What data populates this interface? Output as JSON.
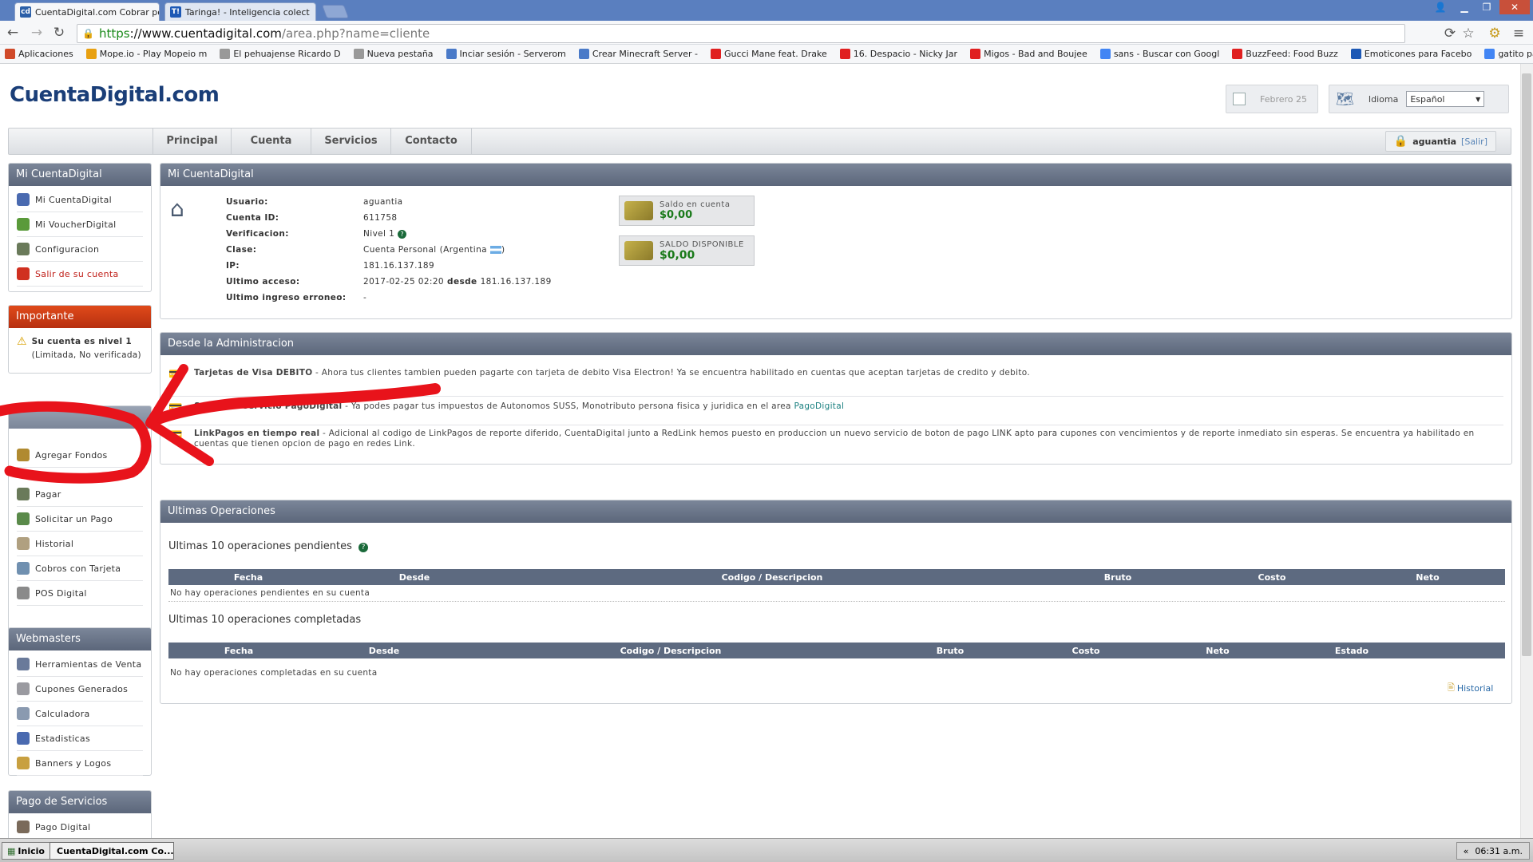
{
  "browser": {
    "tabs": [
      {
        "title": "CuentaDigital.com Cobrar po",
        "active": true,
        "icon": "cd-icon"
      },
      {
        "title": "Taringa! - Inteligencia colect",
        "active": false,
        "icon": "taringa-icon"
      }
    ],
    "url_https": "https",
    "url_host": "://www.cuentadigital.com",
    "url_path": "/area.php?name=cliente",
    "bookmarks": [
      {
        "label": "Aplicaciones",
        "icon": "apps-icon",
        "color": "#d04a2a"
      },
      {
        "label": "Mope.io - Play Mopeio m",
        "icon": "mope-icon",
        "color": "#e8a010"
      },
      {
        "label": "El pehuajense Ricardo D",
        "icon": "page-icon",
        "color": "#999999"
      },
      {
        "label": "Nueva pestaña",
        "icon": "page-icon",
        "color": "#999999"
      },
      {
        "label": "Inciar sesión - Serverom",
        "icon": "server-icon",
        "color": "#4a7ac8"
      },
      {
        "label": "Crear Minecraft Server -",
        "icon": "server-icon",
        "color": "#4a7ac8"
      },
      {
        "label": "Gucci Mane feat. Drake",
        "icon": "youtube-icon",
        "color": "#e02020"
      },
      {
        "label": "16. Despacio - Nicky Jar",
        "icon": "youtube-icon",
        "color": "#e02020"
      },
      {
        "label": "Migos - Bad and Boujee",
        "icon": "youtube-icon",
        "color": "#e02020"
      },
      {
        "label": "sans - Buscar con Googl",
        "icon": "google-icon",
        "color": "#4285f4"
      },
      {
        "label": "BuzzFeed: Food Buzz",
        "icon": "buzzfeed-icon",
        "color": "#e02020"
      },
      {
        "label": "Emoticones para Facebo",
        "icon": "taringa-icon",
        "color": "#1c58b5"
      },
      {
        "label": "gatito para hacer pixel a",
        "icon": "google-icon",
        "color": "#4285f4"
      }
    ]
  },
  "header": {
    "logo_text": "CuentaDigital.com",
    "date": "Febrero 25",
    "idioma_label": "Idioma",
    "idioma_value": "Español"
  },
  "nav": {
    "items": [
      "Principal",
      "Cuenta",
      "Servicios",
      "Contacto"
    ],
    "username": "aguantia",
    "salir": "[Salir]"
  },
  "sidebar": {
    "mi_cuenta": {
      "title": "Mi CuentaDigital",
      "items": [
        {
          "label": "Mi CuentaDigital",
          "icon": "home-icon"
        },
        {
          "label": "Mi VoucherDigital",
          "icon": "voucher-icon"
        },
        {
          "label": "Configuracion",
          "icon": "user-config-icon"
        },
        {
          "label": "Salir de su cuenta",
          "icon": "close-circle-icon"
        }
      ]
    },
    "importante": {
      "title": "Importante",
      "text": "Su cuenta es nivel 1",
      "subtext": "(Limitada, No verificada)"
    },
    "operaciones": {
      "items": [
        {
          "label": "Agregar Fondos",
          "icon": "add-funds-icon"
        },
        {
          "label": "Pagar",
          "icon": "pay-icon"
        },
        {
          "label": "Solicitar un Pago",
          "icon": "request-pay-icon"
        },
        {
          "label": "Historial",
          "icon": "history-icon"
        },
        {
          "label": "Cobros con Tarjeta",
          "icon": "card-icon"
        },
        {
          "label": "POS Digital",
          "icon": "pos-icon"
        }
      ]
    },
    "webmasters": {
      "title": "Webmasters",
      "items": [
        {
          "label": "Herramientas de Venta",
          "icon": "tools-icon"
        },
        {
          "label": "Cupones Generados",
          "icon": "coupons-icon"
        },
        {
          "label": "Calculadora",
          "icon": "calculator-icon"
        },
        {
          "label": "Estadisticas",
          "icon": "stats-icon"
        },
        {
          "label": "Banners y Logos",
          "icon": "banners-icon"
        }
      ]
    },
    "pago_servicios": {
      "title": "Pago de Servicios",
      "items": [
        {
          "label": "Pago Digital",
          "icon": "pago-digital-icon"
        }
      ]
    }
  },
  "account": {
    "title": "Mi CuentaDigital",
    "rows": [
      {
        "k": "Usuario:",
        "v": "aguantia"
      },
      {
        "k": "Cuenta ID:",
        "v": "611758"
      },
      {
        "k": "Verificacion:",
        "v": "Nivel 1"
      },
      {
        "k": "Clase:",
        "v": "Cuenta Personal",
        "extra": "(Argentina"
      },
      {
        "k": "IP:",
        "v": "181.16.137.189"
      },
      {
        "k": "Ultimo acceso:",
        "v": "2017-02-25 02:20",
        "mid": "desde",
        "v2": "181.16.137.189"
      },
      {
        "k": "Ultimo ingreso erroneo:",
        "v": "-"
      }
    ],
    "saldo_cuenta_label": "Saldo en cuenta",
    "saldo_cuenta_value": "$0,00",
    "saldo_disponible_label": "SALDO DISPONIBLE",
    "saldo_disponible_value": "$0,00"
  },
  "admin": {
    "title": "Desde la Administracion",
    "news": [
      {
        "bold": "Tarjetas de Visa DEBITO",
        "text": " - Ahora tus clientes tambien pueden pagarte con tarjeta de debito Visa Electron! Ya se encuentra habilitado en cuentas que aceptan tarjetas de credito y debito."
      },
      {
        "bold": "Se une al servicio PagoDigital",
        "text": " - Ya podes pagar tus impuestos de Autonomos SUSS, Monotributo persona fisica y juridica en el area ",
        "link": "PagoDigital"
      },
      {
        "bold": "LinkPagos en tiempo real",
        "text": " - Adicional al codigo de LinkPagos de reporte diferido, CuentaDigital junto a RedLink hemos puesto en produccion un nuevo servicio de boton de pago LINK apto para cupones con vencimientos y de reporte inmediato sin esperas. Se encuentra ya habilitado en cuentas que tienen opcion de pago en redes Link."
      }
    ]
  },
  "operaciones": {
    "title": "Ultimas Operaciones",
    "pending_title": "Ultimas 10 operaciones pendientes",
    "pending_cols": [
      "Fecha",
      "Desde",
      "Codigo / Descripcion",
      "Bruto",
      "Costo",
      "Neto"
    ],
    "pending_empty": "No hay operaciones pendientes en su cuenta",
    "completed_title": "Ultimas 10 operaciones completadas",
    "completed_cols": [
      "Fecha",
      "Desde",
      "Codigo / Descripcion",
      "Bruto",
      "Costo",
      "Neto",
      "Estado"
    ],
    "completed_empty": "No hay operaciones completadas en su cuenta",
    "historial_link": "Historial"
  },
  "taskbar": {
    "start": "Inicio",
    "app": "CuentaDigital.com Co...",
    "time": "06:31 a.m."
  },
  "colors": {
    "panel_head": "#5b667a",
    "important_head": "#c4380f",
    "annotation": "#e8131b",
    "green_value": "#1a7a1a"
  }
}
